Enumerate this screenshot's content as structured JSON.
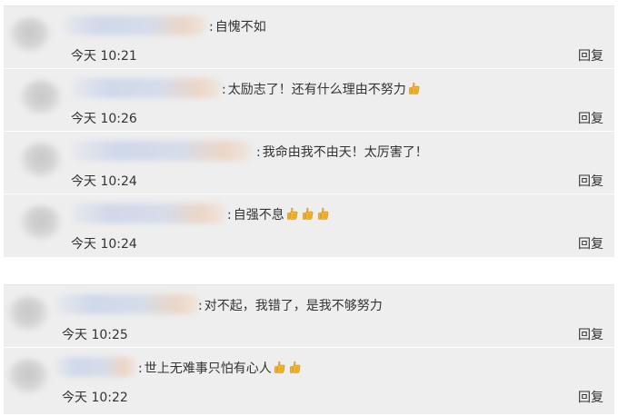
{
  "groups": [
    {
      "comments": [
        {
          "text": "自愧不如",
          "thumbs": 0,
          "time": "今天 10:21",
          "reply": "回复"
        },
        {
          "text": "太励志了！还有什么理由不努力",
          "thumbs": 1,
          "time": "今天 10:26",
          "reply": "回复"
        },
        {
          "text": "我命由我不由天！太厉害了！",
          "thumbs": 0,
          "time": "今天 10:24",
          "reply": "回复"
        },
        {
          "text": "自强不息",
          "thumbs": 3,
          "time": "今天 10:24",
          "reply": "回复"
        }
      ]
    },
    {
      "comments": [
        {
          "text": "对不起，我错了，是我不够努力",
          "thumbs": 0,
          "time": "今天 10:25",
          "reply": "回复"
        },
        {
          "text": "世上无难事只怕有心人",
          "thumbs": 2,
          "time": "今天 10:22",
          "reply": "回复"
        }
      ]
    }
  ],
  "colors": {
    "panel_bg": "#eeeeee",
    "text": "#333333",
    "thumb": "#f5b531"
  },
  "icons": {
    "thumbs_up": "thumbs-up-icon",
    "avatar": "blurred-avatar"
  }
}
